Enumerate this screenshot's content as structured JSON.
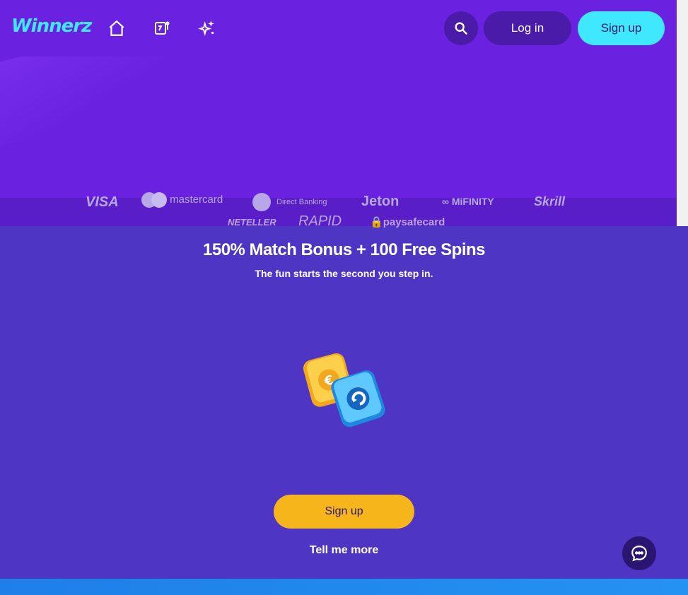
{
  "header": {
    "logo_text": "Winnerz",
    "nav": [
      {
        "icon": "home-icon"
      },
      {
        "icon": "slot-machine-icon"
      },
      {
        "icon": "sparkles-icon"
      }
    ],
    "search_icon": "search-icon",
    "login_label": "Log in",
    "signup_label": "Sign up"
  },
  "payments": {
    "row1": [
      "VISA",
      "mastercard",
      "Direct Banking",
      "Jeton",
      "MiFINITY",
      "Skrill"
    ],
    "row2": [
      "NETELLER",
      "RAPID",
      "paysafecard"
    ]
  },
  "promo": {
    "title": "150% Match Bonus + 100 Free Spins",
    "subtitle": "The fun starts the second you step in.",
    "cta_label": "Sign up",
    "more_label": "Tell me more"
  },
  "chat": {
    "icon": "chat-icon"
  },
  "colors": {
    "brand": "#6a22e0",
    "accent_cyan": "#3fe7ff",
    "cta_yellow": "#f7b51c",
    "promo_bg": "#4f35c4",
    "bottom_blue": "#1e7fe8"
  }
}
